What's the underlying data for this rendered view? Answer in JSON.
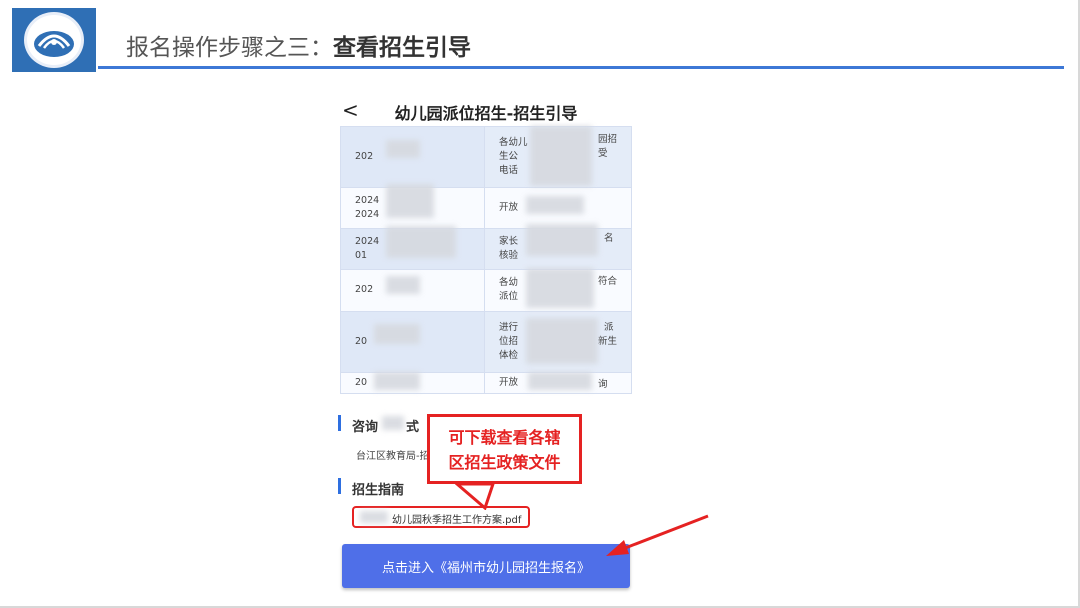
{
  "slide": {
    "title_prefix": "报名操作步骤之三：",
    "title_bold": "查看招生引导"
  },
  "phone": {
    "back_glyph": "<",
    "title": "幼儿园派位招生-招生引导",
    "schedule_rows": [
      {
        "date": [
          "202"
        ],
        "desc": [
          "各幼儿",
          "生公",
          "电话"
        ],
        "tail": [
          "园招",
          "受"
        ]
      },
      {
        "date": [
          "2024",
          "2024"
        ],
        "desc": [
          "开放"
        ],
        "tail": []
      },
      {
        "date": [
          "2024",
          "01"
        ],
        "desc": [
          "家长",
          "核验"
        ],
        "tail": [
          "名"
        ]
      },
      {
        "date": [
          "202"
        ],
        "desc": [
          "各幼",
          "派位"
        ],
        "tail": [
          "符合"
        ]
      },
      {
        "date": [
          "20"
        ],
        "desc": [
          "进行",
          "位招",
          "体检"
        ],
        "tail": [
          "派",
          "新生"
        ]
      },
      {
        "date": [
          "20"
        ],
        "desc": [
          "开放"
        ],
        "tail": [
          "询"
        ]
      }
    ],
    "consult": {
      "title": "咨询",
      "title_tail": "式",
      "text": "台江区教育局-招"
    },
    "guide": {
      "title": "招生指南",
      "file_name": "幼儿园秋季招生工作方案.pdf"
    },
    "enroll_button": "点击进入《福州市幼儿园招生报名》"
  },
  "callout": {
    "line1": "可下载查看各辖",
    "line2": "区招生政策文件"
  },
  "colors": {
    "accent": "#3d78d6",
    "button": "#4f6fe8",
    "highlight": "#e52222"
  }
}
